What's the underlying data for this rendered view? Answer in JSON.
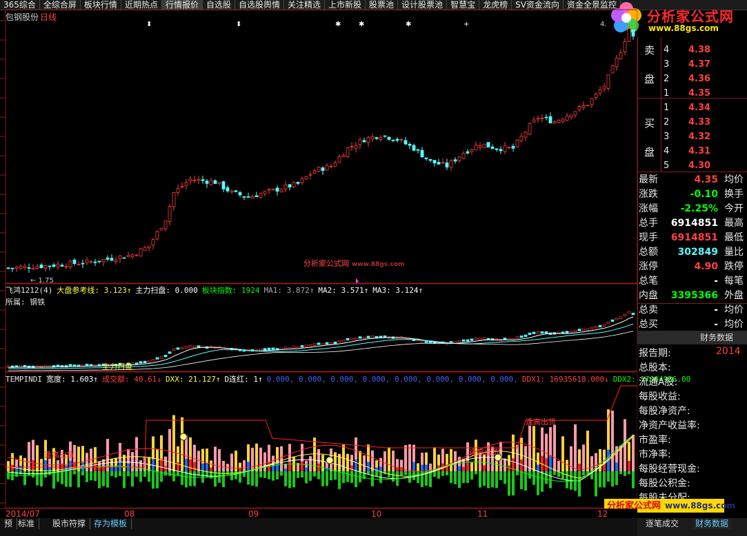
{
  "menu": [
    "365综合",
    "全综合屏",
    "板块行情",
    "近期热点",
    "行情报价",
    "自选股",
    "自选股舆情",
    "关注精选",
    "上市新股",
    "股票池",
    "设计股票池",
    "智慧宝",
    "龙虎榜",
    "SV资金流向",
    "资金全景监控"
  ],
  "menu_active": 4,
  "logo": {
    "name": "分析家公式网",
    "url": "www.88gs.com"
  },
  "stock": {
    "name": "包钢股份",
    "period": "日线"
  },
  "chart": {
    "low_label": "1.75",
    "high_label": "4.",
    "watermark_name": "分析家公式网",
    "watermark_url": "www.88gs.com",
    "colors": {
      "up": "#ff3b3b",
      "down": "#54ffff",
      "ma_white": "#ffffff",
      "ma_yellow": "#ffff00",
      "ma_green": "#00cc00"
    }
  },
  "indicator1": {
    "title": "飞鸿1212(4)",
    "items": [
      {
        "label": "大盘参考线: ",
        "value": "3.123↑",
        "color": "#ffff40"
      },
      {
        "label": "主力扫盘: ",
        "value": "0.000",
        "color": "#ffffff"
      },
      {
        "label": "板块指数: ",
        "value": "1924",
        "color": "#00ff00"
      },
      {
        "label": "MA1: ",
        "value": "3.872↑",
        "color": "#aaaaaa"
      },
      {
        "label": "MA2: ",
        "value": "3.571↑",
        "color": "#ffffff"
      },
      {
        "label": "MA3: ",
        "value": "3.124↑",
        "color": "#ffffff"
      }
    ],
    "sector": "所属: 钢铁",
    "annotation": "主力扫盘"
  },
  "indicator2": {
    "title": "TEMPINDI",
    "items": [
      {
        "label": "宽度: ",
        "value": "1.603↑",
        "color": "#ffffff"
      },
      {
        "label": "成交额: ",
        "value": "40.61↓",
        "color": "#ff4040"
      },
      {
        "label": "DXX: ",
        "value": "21.127↑",
        "color": "#ffff40"
      },
      {
        "label": "D连红: ",
        "value": "1↑",
        "color": "#ffffff"
      },
      {
        "label": "",
        "value": "0.000, 0.000, 0.000, 0.000, 0.000, 0.000, 0.000, 0.000,",
        "color": "#4060ff"
      },
      {
        "label": "DDX1: ",
        "value": "16935618.000↓",
        "color": "#ff4040"
      },
      {
        "label": "DDX2: ",
        "value": "17004956.00",
        "color": "#00ff00"
      }
    ],
    "annotation1": "逢高出货",
    "annotation2": "逢高出货",
    "annotation3": "逢高出货"
  },
  "x_axis": [
    "2014/07",
    "08",
    "09",
    "10",
    "11",
    "12"
  ],
  "orderbook": {
    "sell_label": [
      "卖",
      "盘"
    ],
    "buy_label": [
      "买",
      "盘"
    ],
    "sell": [
      {
        "level": "4",
        "price": "4.38"
      },
      {
        "level": "3",
        "price": "4.37"
      },
      {
        "level": "2",
        "price": "4.36"
      },
      {
        "level": "1",
        "price": "4.35"
      }
    ],
    "buy": [
      {
        "level": "1",
        "price": "4.34"
      },
      {
        "level": "2",
        "price": "4.33"
      },
      {
        "level": "3",
        "price": "4.32"
      },
      {
        "level": "4",
        "price": "4.31"
      },
      {
        "level": "5",
        "price": "4.30"
      }
    ]
  },
  "quote": [
    {
      "k": "最新",
      "v": "4.35",
      "vc": "#ff4040",
      "k2": "均价"
    },
    {
      "k": "涨跌",
      "v": "-0.10",
      "vc": "#00ff00",
      "k2": "换手"
    },
    {
      "k": "涨幅",
      "v": "-2.25%",
      "vc": "#00ff00",
      "k2": "今开"
    },
    {
      "k": "总手",
      "v": "6914851",
      "vc": "#ffffff",
      "k2": "最高"
    },
    {
      "k": "现手",
      "v": "6914851",
      "vc": "#ff4040",
      "k2": "最低"
    },
    {
      "k": "总额",
      "v": "302849",
      "vc": "#54ffff",
      "k2": "量比"
    },
    {
      "k": "涨停",
      "v": "4.90",
      "vc": "#ff4040",
      "k2": "跌停"
    },
    {
      "k": "总笔",
      "v": "-",
      "vc": "#ffffff",
      "k2": "每笔"
    },
    {
      "k": "内盘",
      "v": "3395366",
      "vc": "#00ff00",
      "k2": "外盘"
    },
    {
      "k": "总卖",
      "v": "-",
      "vc": "#ffffff",
      "k2": "均价"
    },
    {
      "k": "总买",
      "v": "-",
      "vc": "#ffffff",
      "k2": "均价"
    }
  ],
  "financial": {
    "header": "财务数据",
    "report_label": "报告期:",
    "report_value": "2014",
    "rows": [
      "总股本:",
      "流通A股:",
      "每股收益:",
      "每股净资产:",
      "净资产收益率:",
      "市盈率:",
      "市净率:",
      "每股经营现金:",
      "每股公积金:",
      "每股未分配:"
    ]
  },
  "bottom_tabs": [
    "预",
    "标准",
    "股市符撑",
    "存为模板"
  ],
  "bottom_tab_selected": 3,
  "right_tabs": [
    "逐笔成交",
    "财务数据"
  ],
  "right_tab_selected": 1,
  "bottom_logo": {
    "name": "分析家公式网",
    "url": "www.88gs.com"
  }
}
